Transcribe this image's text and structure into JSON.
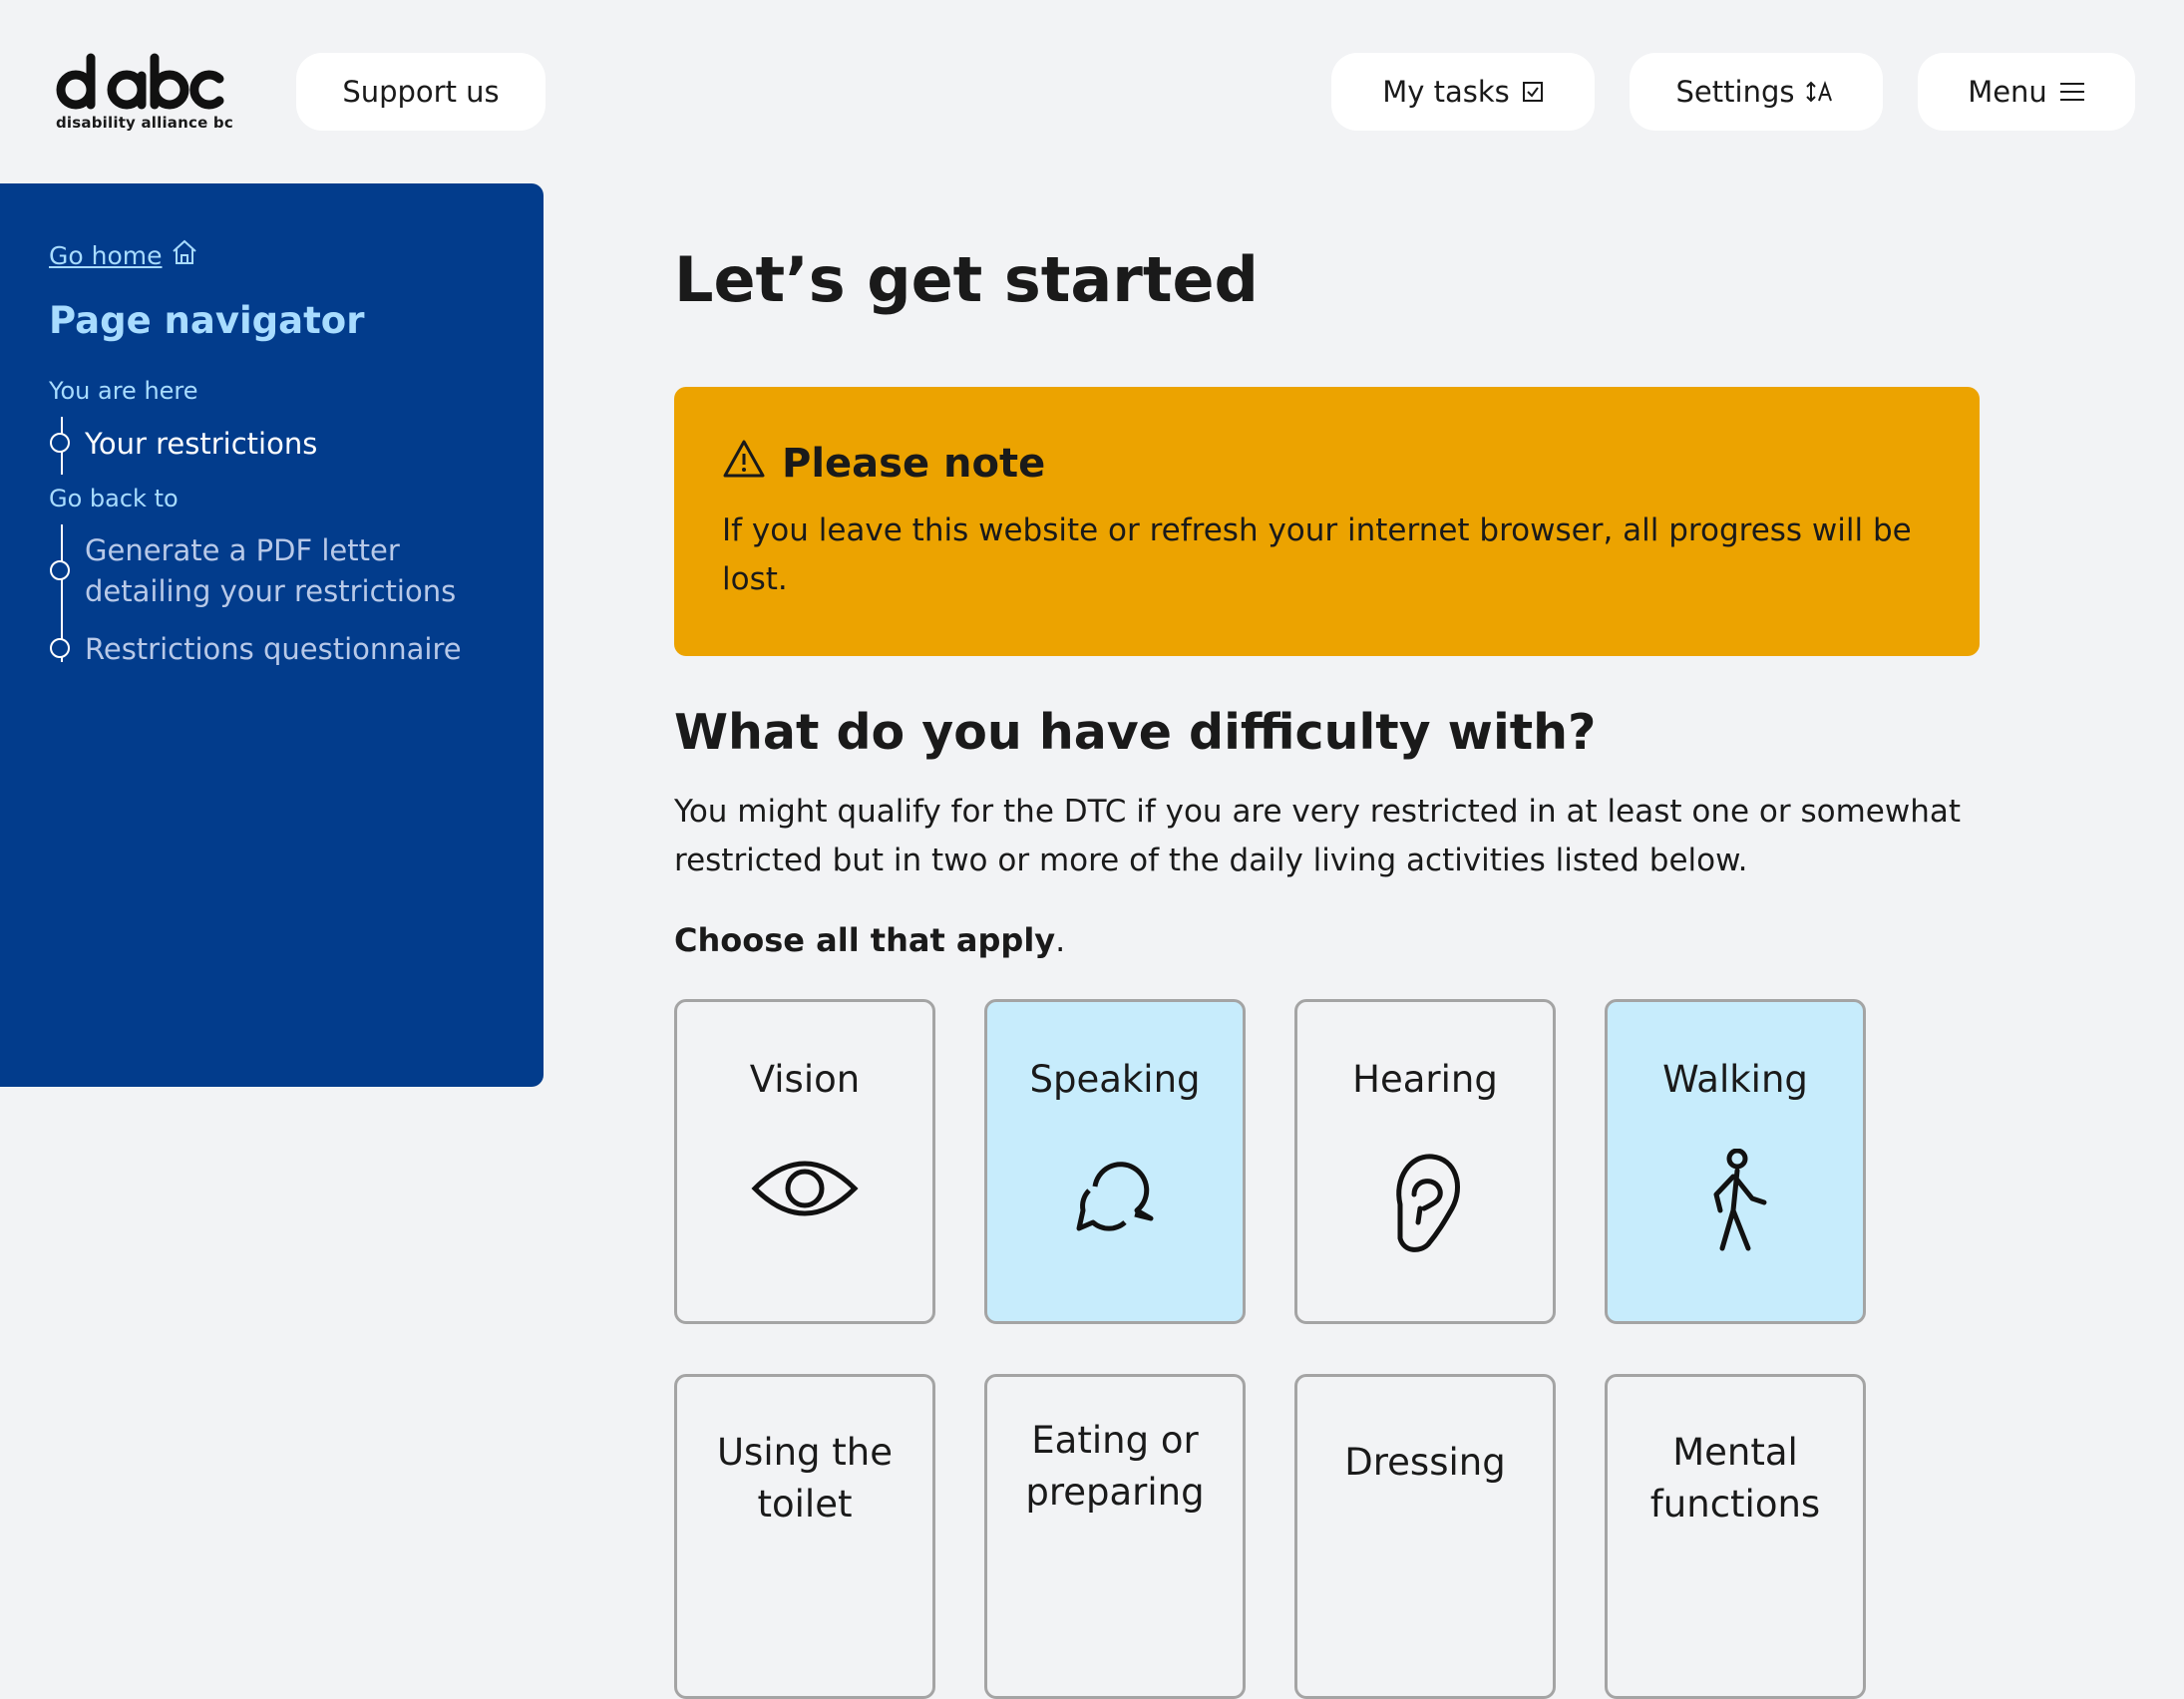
{
  "header": {
    "logo_text": "dabc",
    "logo_subtitle": "disability alliance bc",
    "support_label": "Support us",
    "tasks_label": "My tasks",
    "settings_label": "Settings",
    "menu_label": "Menu"
  },
  "sidebar": {
    "go_home": "Go home",
    "title": "Page navigator",
    "you_are_here": "You are here",
    "current_item": "Your restrictions",
    "go_back_to": "Go back to",
    "back_items": [
      "Generate a PDF letter detailing your restrictions",
      "Restrictions questionnaire"
    ]
  },
  "main": {
    "title": "Let’s get started",
    "note_title": "Please note",
    "note_body": "If you leave this website or refresh your internet browser, all progress will be lost.",
    "question": "What do you have difficulty with?",
    "description": "You might qualify for the DTC if you are very restricted in at least one or somewhat restricted but in two or more of the daily living activities listed below.",
    "choose_bold": "Choose all that apply",
    "choose_end": ".",
    "options": [
      {
        "label": "Vision",
        "icon": "eye-icon",
        "selected": false
      },
      {
        "label": "Speaking",
        "icon": "speech-bubbles-icon",
        "selected": true
      },
      {
        "label": "Hearing",
        "icon": "ear-icon",
        "selected": false
      },
      {
        "label": "Walking",
        "icon": "walking-person-icon",
        "selected": true
      },
      {
        "label": "Using the toilet",
        "selected": false
      },
      {
        "label": "Eating or preparing",
        "selected": false
      },
      {
        "label": "Dressing",
        "selected": false
      },
      {
        "label": "Mental functions",
        "selected": false
      }
    ]
  },
  "colors": {
    "sidebar_bg": "#023c8c",
    "note_bg": "#eca300",
    "selected_card": "#c7ecfc",
    "link_light_blue": "#a8dcff"
  }
}
